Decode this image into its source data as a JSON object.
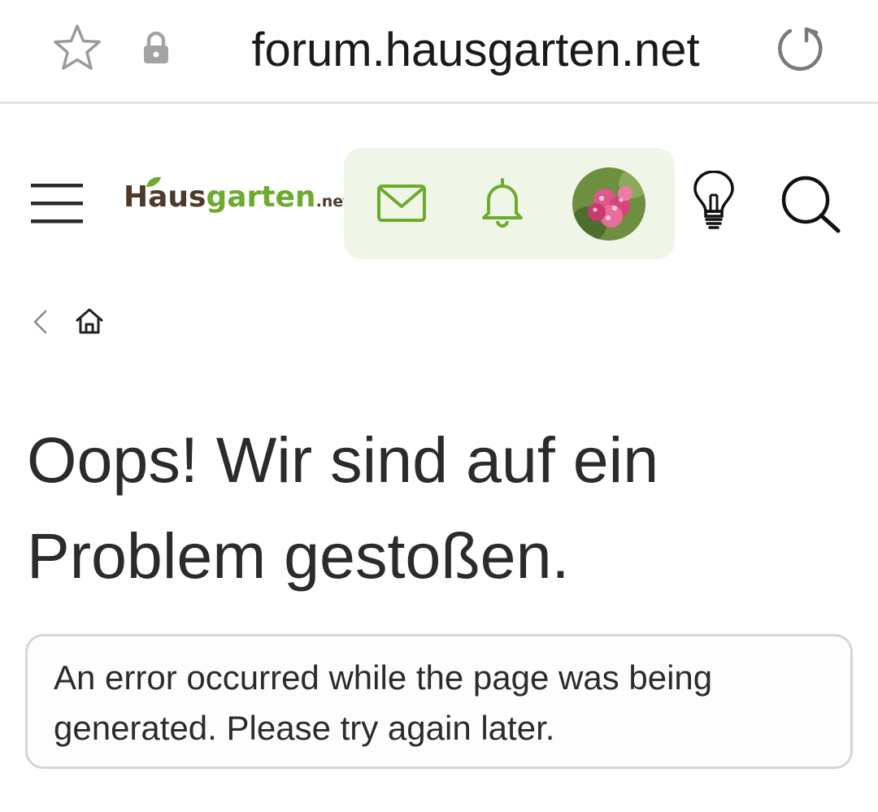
{
  "browser": {
    "url": "forum.hausgarten.net",
    "icons": {
      "bookmark": "star-icon",
      "secure": "lock-icon",
      "reload": "reload-icon"
    }
  },
  "header": {
    "logo": {
      "main": "Hausgarten",
      "suffix": ".net"
    },
    "icons": {
      "menu": "hamburger-menu-icon",
      "conversations": "mail-icon",
      "alerts": "bell-icon",
      "avatar": "user-avatar-flower",
      "whats_new": "lightbulb-icon",
      "search": "search-icon"
    },
    "colors": {
      "brand_brown": "#4e3a2a",
      "brand_green": "#6cab2e",
      "panel_bg": "#eff6e8"
    }
  },
  "breadcrumb": {
    "icons": {
      "back": "chevron-left-icon",
      "home": "home-icon"
    }
  },
  "main": {
    "title": "Oops! Wir sind auf ein Problem gestoßen.",
    "error_message": "An error occurred while the page was being generated. Please try again later."
  }
}
